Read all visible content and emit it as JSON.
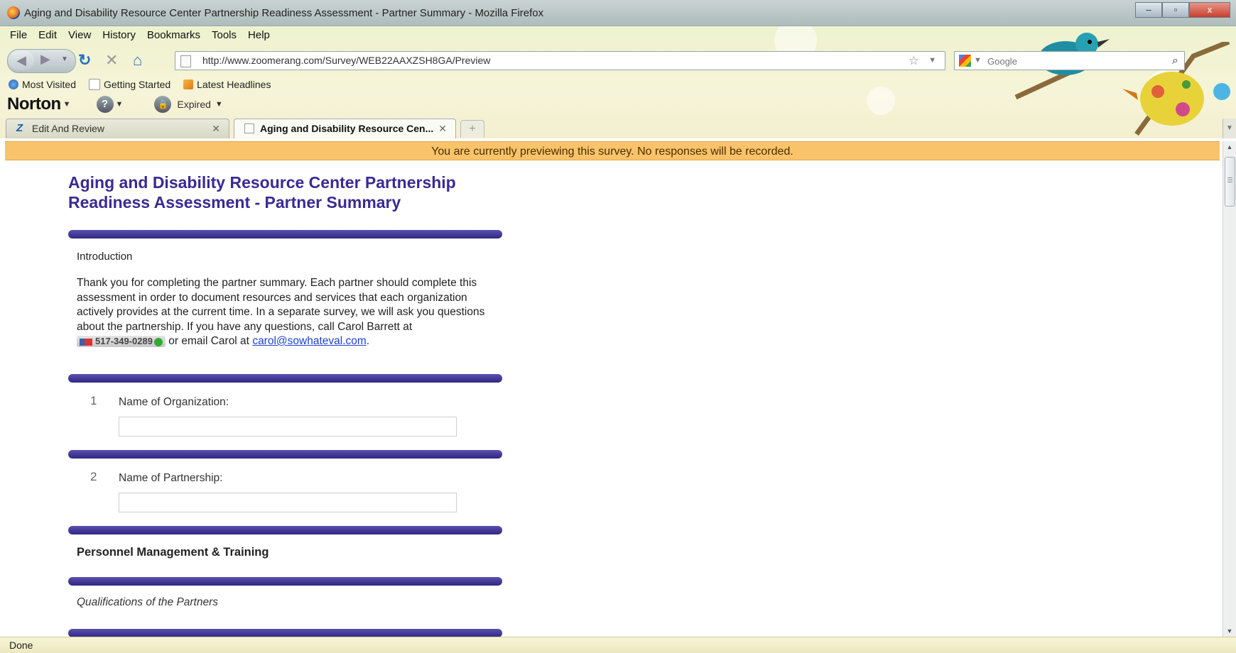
{
  "window": {
    "title": "Aging and Disability Resource Center Partnership Readiness Assessment - Partner Summary - Mozilla Firefox",
    "controls": {
      "minimize": "–",
      "maximize": "▫",
      "close": "x"
    }
  },
  "menu": [
    "File",
    "Edit",
    "View",
    "History",
    "Bookmarks",
    "Tools",
    "Help"
  ],
  "navigation": {
    "url": "http://www.zoomerang.com/Survey/WEB22AAXZSH8GA/Preview",
    "search_placeholder": "Google"
  },
  "bookmarks": [
    {
      "label": "Most Visited",
      "icon": "globe-icon"
    },
    {
      "label": "Getting Started",
      "icon": "page-icon"
    },
    {
      "label": "Latest Headlines",
      "icon": "rss-icon"
    }
  ],
  "norton": {
    "logo": "Norton",
    "expired_label": "Expired"
  },
  "tabs": [
    {
      "label": "Edit And Review",
      "icon": "zoomerang-z-icon",
      "active": false
    },
    {
      "label": "Aging and Disability Resource Cen...",
      "icon": "page-icon",
      "active": true
    }
  ],
  "preview_notice": "You are currently previewing this survey. No responses will be recorded.",
  "survey": {
    "title_line1": "Aging and Disability Resource Center Partnership",
    "title_line2": "Readiness Assessment - Partner Summary",
    "intro_heading": "Introduction",
    "intro_text_before_phone": "Thank you for completing the partner summary.  Each partner should complete this assessment in order to document resources and services that each organization actively provides at the current time.   In a separate survey, we will ask you questions about the partnership.  If you have any questions, call Carol Barrett at",
    "phone": "517-349-0289",
    "intro_text_after_phone": "or email Carol at",
    "email": "carol@sowhateval.com",
    "questions": [
      {
        "number": "1",
        "label": "Name of Organization:",
        "value": ""
      },
      {
        "number": "2",
        "label": "Name of Partnership:",
        "value": ""
      }
    ],
    "section_title": "Personnel Management & Training",
    "subsection_title": "Qualifications of the Partners"
  },
  "status": "Done",
  "colors": {
    "title_purple": "#3a2a93",
    "separator": "#3b3290",
    "preview_bar": "#f9c36b",
    "link": "#1f3fd6"
  }
}
